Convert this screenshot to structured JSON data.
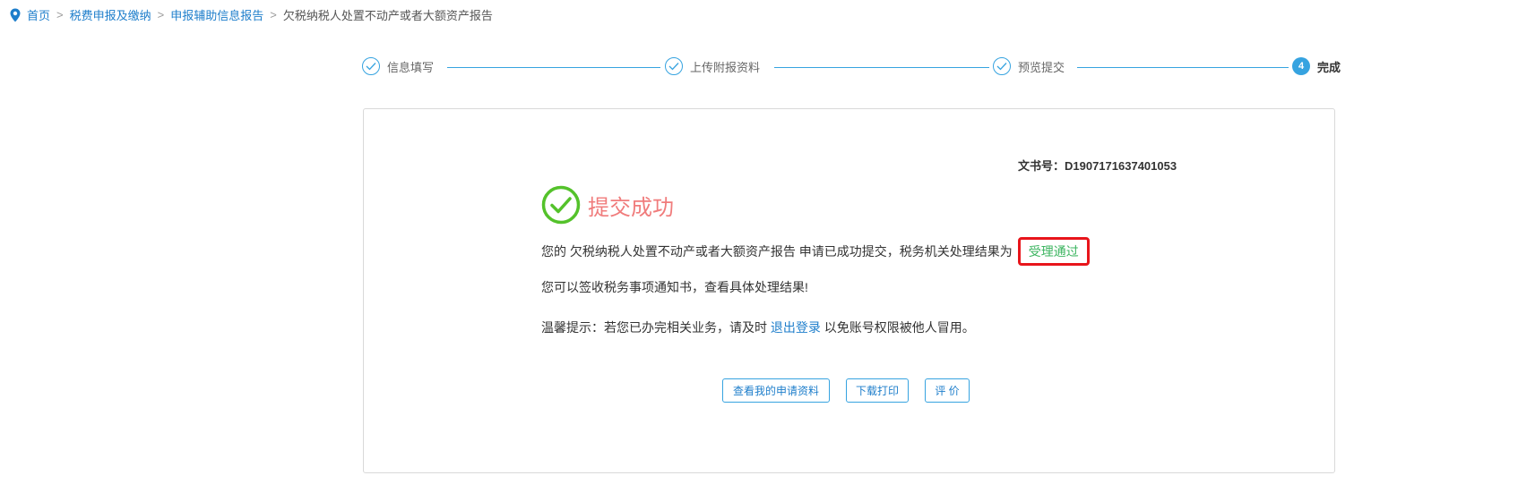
{
  "breadcrumb": {
    "items": [
      "首页",
      "税费申报及缴纳",
      "申报辅助信息报告"
    ],
    "separator": ">",
    "current": "欠税纳税人处置不动产或者大额资产报告"
  },
  "steps": [
    {
      "label": "信息填写",
      "state": "done"
    },
    {
      "label": "上传附报资料",
      "state": "done"
    },
    {
      "label": "预览提交",
      "state": "done"
    },
    {
      "label": "完成",
      "number": "4",
      "state": "active"
    }
  ],
  "document": {
    "number_label": "文书号：D1907171637401053"
  },
  "result": {
    "title": "提交成功",
    "line1_prefix": "您的 欠税纳税人处置不动产或者大额资产报告 申请已成功提交，税务机关处理结果为",
    "status": "受理通过",
    "line2": "您可以签收税务事项通知书，查看具体处理结果!",
    "line3_prefix": "温馨提示：若您已办完相关业务，请及时",
    "logout_link": "退出登录",
    "line3_suffix": "以免账号权限被他人冒用。"
  },
  "buttons": {
    "view_materials": "查看我的申请资料",
    "download_print": "下载打印",
    "evaluate": "评 价"
  },
  "colors": {
    "accent": "#36a3e0",
    "link": "#1e7ecb",
    "success_green": "#54c22b",
    "title_red": "#f07c7c",
    "highlight_border": "#e8151b"
  }
}
